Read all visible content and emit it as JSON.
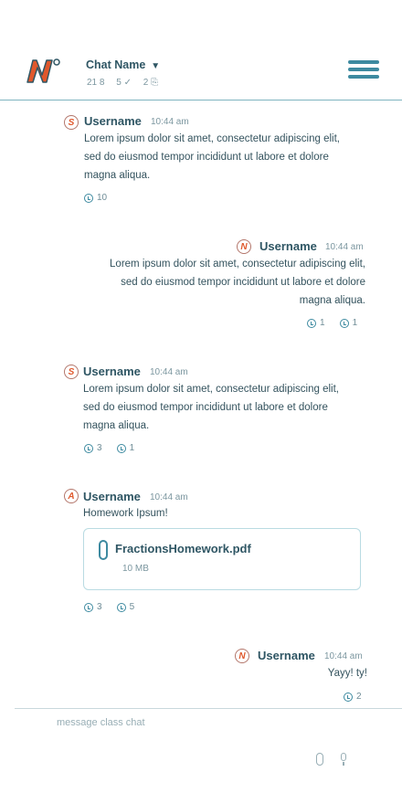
{
  "header": {
    "chat_name": "Chat Name",
    "caret": "▼",
    "stats": [
      "21 8",
      "5 ✓",
      "2 ⎘"
    ],
    "logo_text": "N"
  },
  "messages": [
    {
      "avatar": "S",
      "username": "Username",
      "time": "10:44 am",
      "lines": [
        "Lorem ipsum dolor sit amet, consectetur adipiscing elit,",
        "sed do eiusmod tempor incididunt ut labore et dolore",
        "magna aliqua."
      ],
      "reactions": [
        {
          "icon": "clock-icon",
          "count": "10"
        }
      ]
    },
    {
      "avatar": "N",
      "username": "Username",
      "time": "10:44 am",
      "lines": [
        "Lorem ipsum dolor sit amet, consectetur adipiscing elit,",
        "sed do eiusmod tempor incididunt ut labore et dolore",
        "magna aliqua."
      ],
      "reactions": [
        {
          "icon": "face-icon",
          "count": "1"
        },
        {
          "icon": "hand-icon",
          "count": "1"
        }
      ]
    },
    {
      "avatar": "S",
      "username": "Username",
      "time": "10:44 am",
      "lines": [
        "Lorem ipsum dolor sit amet, consectetur adipiscing elit,",
        "sed do eiusmod tempor incididunt ut labore et dolore",
        "magna aliqua."
      ],
      "reactions": [
        {
          "icon": "clock-icon",
          "count": "3"
        },
        {
          "icon": "laugh-icon",
          "count": "1"
        }
      ]
    },
    {
      "avatar": "A",
      "username": "Username",
      "time": "10:44 am",
      "lines": [
        "Homework Ipsum!"
      ],
      "file": {
        "name": "FractionsHomework.pdf",
        "size": "10 MB"
      },
      "reactions": [
        {
          "icon": "smile-icon",
          "count": "3"
        },
        {
          "icon": "laugh-icon",
          "count": "5"
        }
      ]
    },
    {
      "avatar": "N",
      "username": "Username",
      "time": "10:44 am",
      "lines": [
        "Yayy! ty!"
      ],
      "reactions": [
        {
          "icon": "laugh-icon",
          "count": "2"
        }
      ]
    }
  ],
  "composer": {
    "placeholder": "message class chat"
  },
  "colors": {
    "accent": "#3d8aa0",
    "brand_orange": "#e0582c",
    "text": "#2f5664"
  }
}
